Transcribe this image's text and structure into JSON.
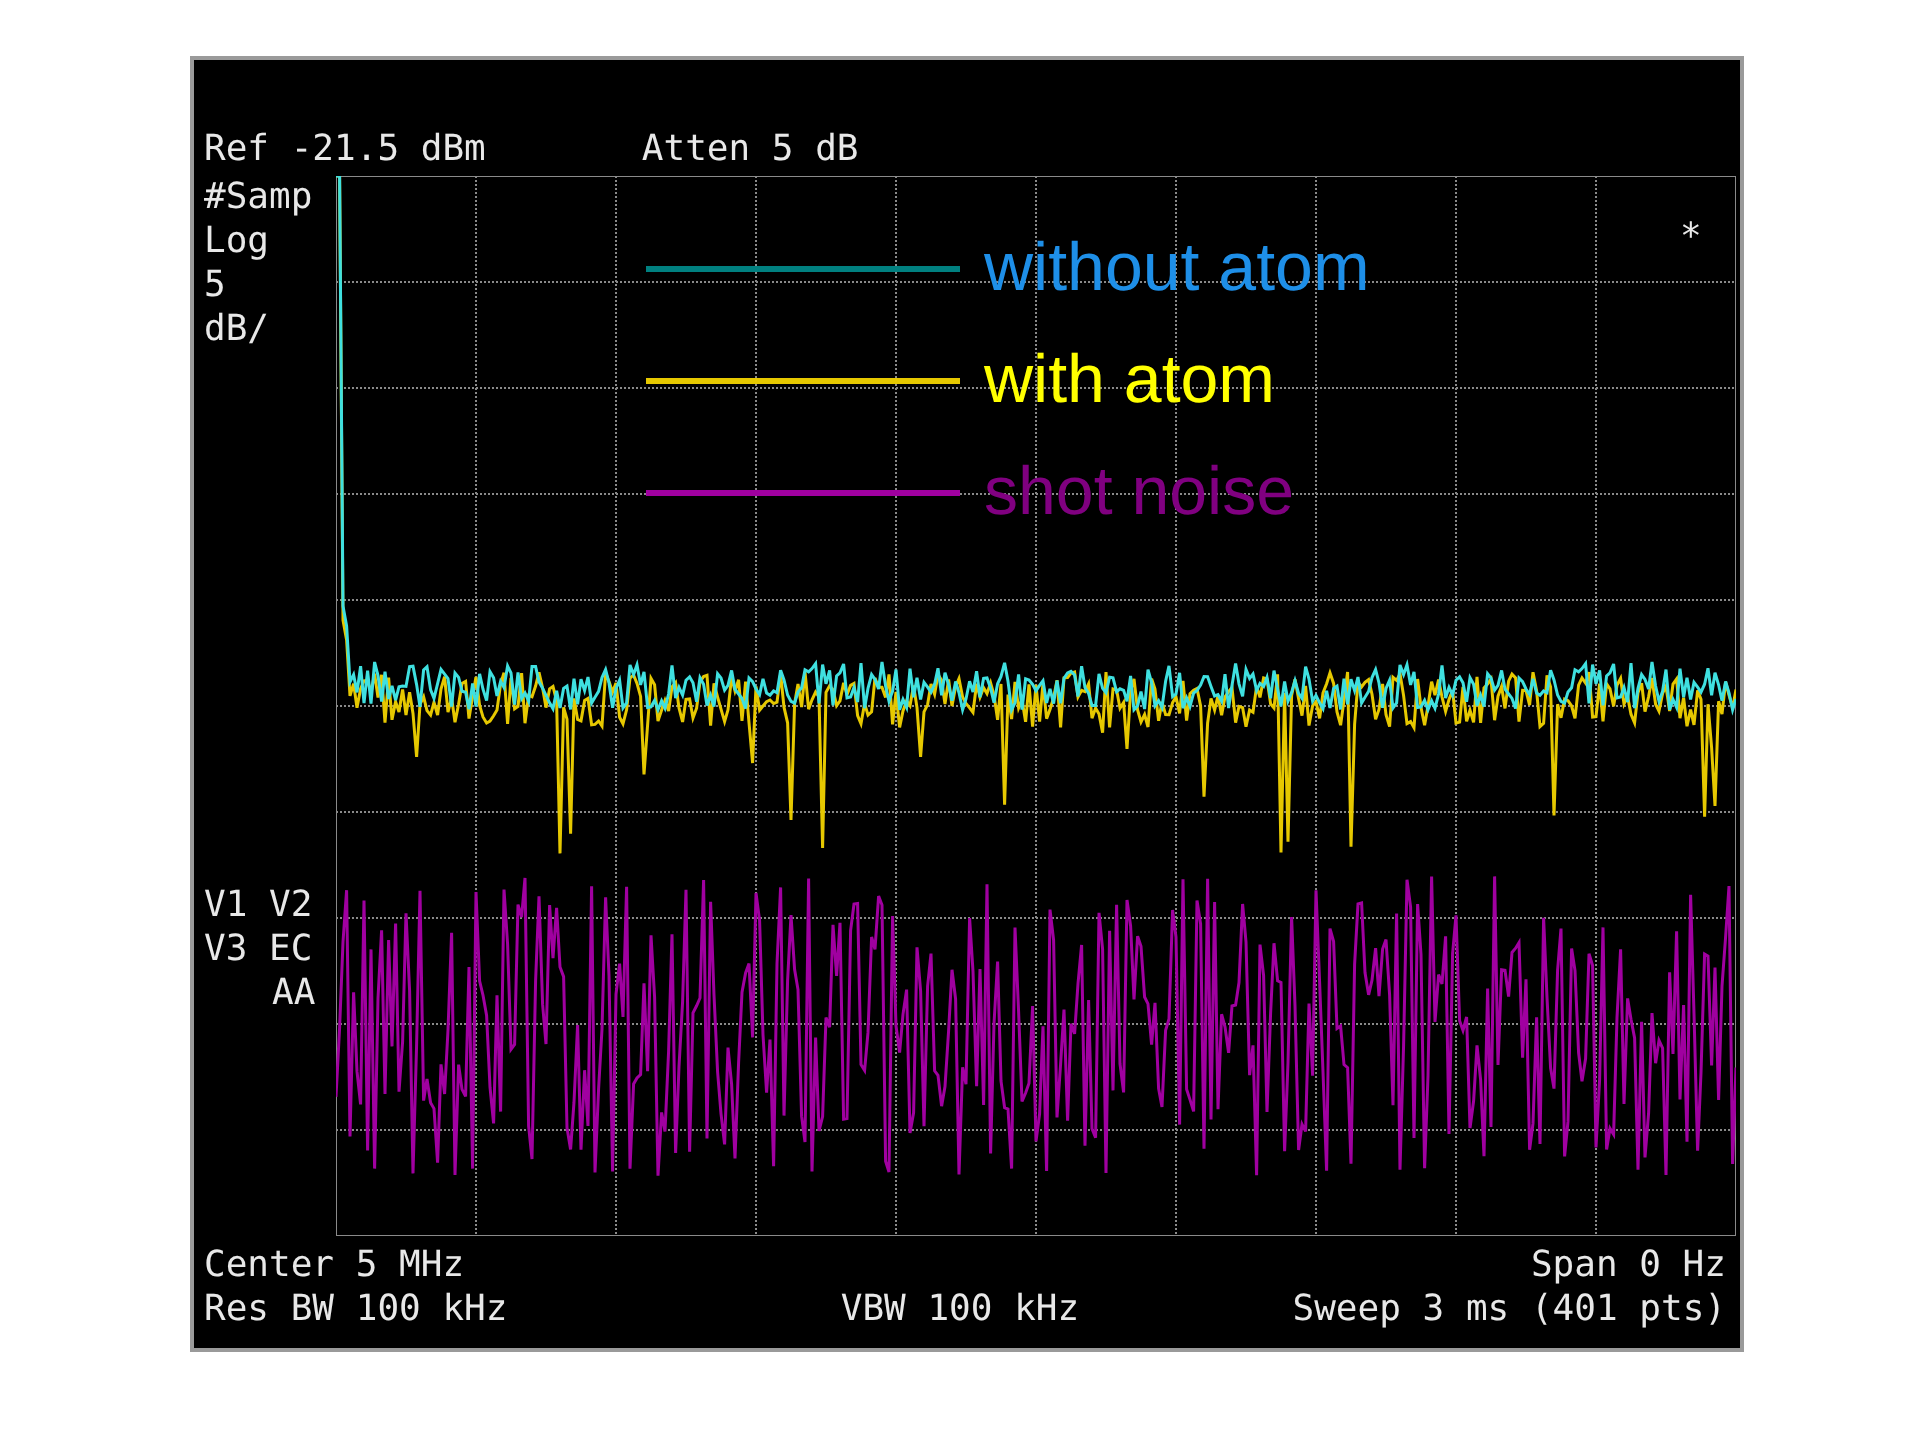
{
  "header": {
    "reference": "Ref -21.5 dBm",
    "attenuation": "Atten 5 dB"
  },
  "side_labels": [
    "#Samp",
    "Log",
    "5",
    "dB/"
  ],
  "marker": "*",
  "status_labels": [
    "V1 V2",
    "V3 EC",
    "AA"
  ],
  "legend": [
    {
      "label": "without atom",
      "color": "#1e8fe8",
      "line": {
        "color": "#008080"
      }
    },
    {
      "label": "with atom",
      "color": "#ffff00",
      "line": {
        "color": "#e6c800"
      }
    },
    {
      "label": "shot noise",
      "color": "#800080",
      "line": {
        "color": "#a000a0"
      }
    }
  ],
  "footer": {
    "center": "Center 5 MHz",
    "span": "Span 0 Hz",
    "res_bw": "Res BW 100 kHz",
    "vbw": "VBW 100 kHz",
    "sweep": "Sweep 3 ms (401 pts)"
  }
}
